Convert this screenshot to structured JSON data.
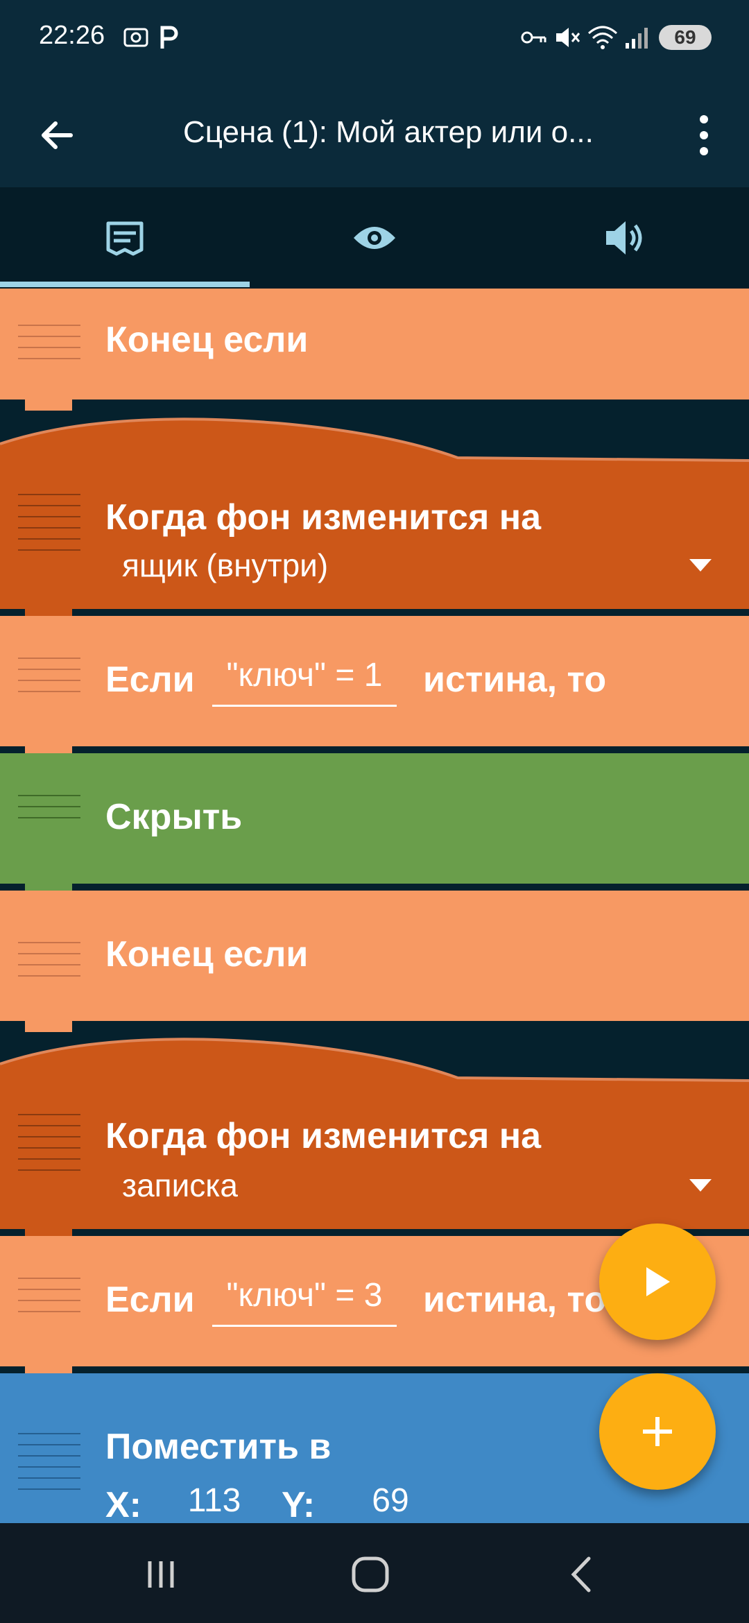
{
  "status_bar": {
    "time": "22:26",
    "battery": "69",
    "icons": [
      "screenshot-icon",
      "parking-icon",
      "vpn-key-icon",
      "mute-icon",
      "wifi-icon",
      "signal-icon",
      "battery-icon"
    ]
  },
  "app_bar": {
    "title": "Сцена (1): Мой актер или о...",
    "back_icon": "arrow-left-icon",
    "menu_icon": "more-vert-icon"
  },
  "tabs": [
    {
      "name": "scripts",
      "icon": "script-icon",
      "selected": true
    },
    {
      "name": "looks",
      "icon": "eye-icon",
      "selected": false
    },
    {
      "name": "sounds",
      "icon": "speaker-icon",
      "selected": false
    }
  ],
  "blocks": {
    "b1": {
      "label": "Конец если"
    },
    "b2": {
      "label": "Когда фон изменится на",
      "value": "ящик (внутри)"
    },
    "b3": {
      "label": "Если",
      "field": "\"ключ\" = 1",
      "suffix": "истина, то"
    },
    "b4": {
      "label": "Скрыть"
    },
    "b5": {
      "label": "Конец если"
    },
    "b6": {
      "label": "Когда фон изменится на",
      "value": "записка"
    },
    "b7": {
      "label": "Если",
      "field": "\"ключ\" = 3",
      "suffix": "истина, то"
    },
    "b8": {
      "label": "Поместить в",
      "x_label": "X:",
      "x_value": "113",
      "y_label": "Y:",
      "y_value": "69"
    }
  },
  "colors": {
    "control_light": "#f79963",
    "event_dark": "#cc5718",
    "looks_green": "#6a9e4b",
    "motion_blue": "#3f89c6",
    "fab": "#fdae12"
  },
  "fabs": {
    "play_icon": "play-icon",
    "add_icon": "plus-icon"
  },
  "nav_bar": {
    "icons": [
      "recent-apps-icon",
      "home-icon",
      "back-icon"
    ]
  }
}
